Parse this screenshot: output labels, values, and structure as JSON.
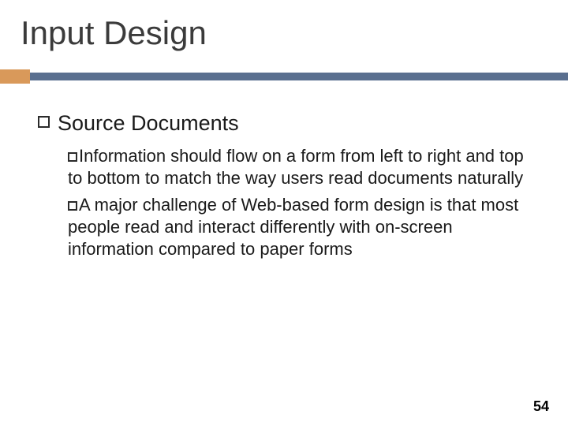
{
  "title": "Input Design",
  "content": {
    "level1": "Source Documents",
    "sub1_lead": "Information",
    "sub1_rest": " should flow on a form from left to right and top to bottom to match the way users read documents naturally",
    "sub2_lead": "A",
    "sub2_rest": " major challenge of Web-based form design is that most people read and interact differently with on-screen information compared to paper forms"
  },
  "page_number": "54"
}
